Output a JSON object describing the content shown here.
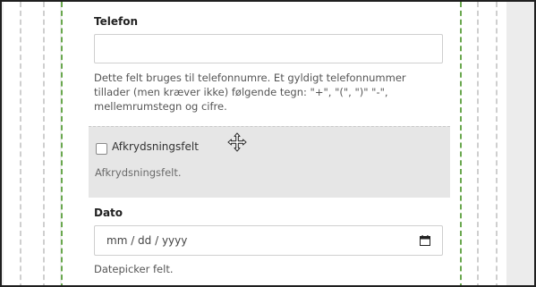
{
  "telefon": {
    "label": "Telefon",
    "value": "",
    "help": "Dette felt bruges til telefonnumre. Et gyldigt telefonnummer tillader (men kræver ikke) følgende tegn: \"+\", \"(\", \")\" \"-\", mellemrumstegn og cifre."
  },
  "checkbox_field": {
    "label": "Afkrydsningsfelt",
    "help": "Afkrydsningsfelt.",
    "checked": false,
    "drag_icon": "move-icon"
  },
  "dato": {
    "label": "Dato",
    "placeholder": "mm / dd / yyyy",
    "help": "Datepicker felt.",
    "icon": "calendar-icon"
  }
}
